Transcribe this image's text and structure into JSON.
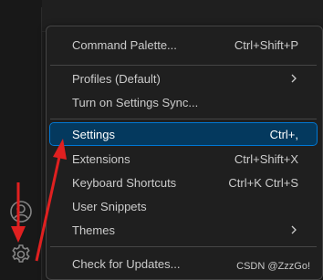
{
  "activity_bar": {
    "account_icon": "account-icon",
    "manage_icon": "gear-icon"
  },
  "menu": {
    "items": [
      {
        "label": "Command Palette...",
        "shortcut": "Ctrl+Shift+P"
      },
      {
        "label": "Profiles (Default)",
        "submenu": true
      },
      {
        "label": "Turn on Settings Sync..."
      },
      {
        "label": "Settings",
        "shortcut": "Ctrl+,",
        "selected": true
      },
      {
        "label": "Extensions",
        "shortcut": "Ctrl+Shift+X"
      },
      {
        "label": "Keyboard Shortcuts",
        "shortcut": "Ctrl+K Ctrl+S"
      },
      {
        "label": "User Snippets"
      },
      {
        "label": "Themes",
        "submenu": true
      },
      {
        "label": "Check for Updates..."
      }
    ]
  },
  "watermark": "CSDN @ZzzGo!",
  "colors": {
    "selection_bg": "#04395e",
    "selection_border": "#0078d4",
    "annotation": "#e02020"
  }
}
